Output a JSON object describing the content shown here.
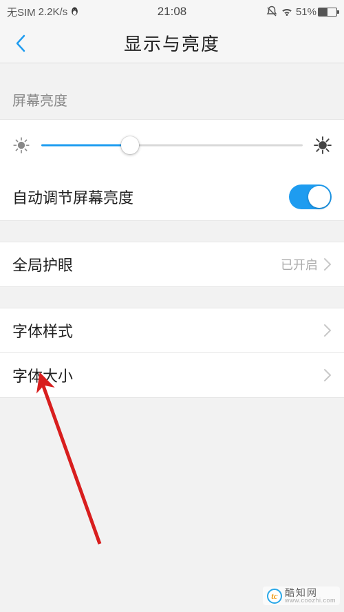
{
  "status": {
    "carrier": "无SIM",
    "net_speed": "2.2K/s",
    "time": "21:08",
    "battery_pct": "51%",
    "battery_level": 51
  },
  "nav": {
    "title": "显示与亮度"
  },
  "brightness": {
    "section_label": "屏幕亮度",
    "value_pct": 34,
    "auto_label": "自动调节屏幕亮度",
    "auto_on": true
  },
  "rows": {
    "eyecare": {
      "label": "全局护眼",
      "value": "已开启"
    },
    "font_style": {
      "label": "字体样式"
    },
    "font_size": {
      "label": "字体大小"
    }
  },
  "watermark": {
    "name": "酷知网",
    "url": "www.coozhi.com",
    "logo_text": "tc"
  }
}
